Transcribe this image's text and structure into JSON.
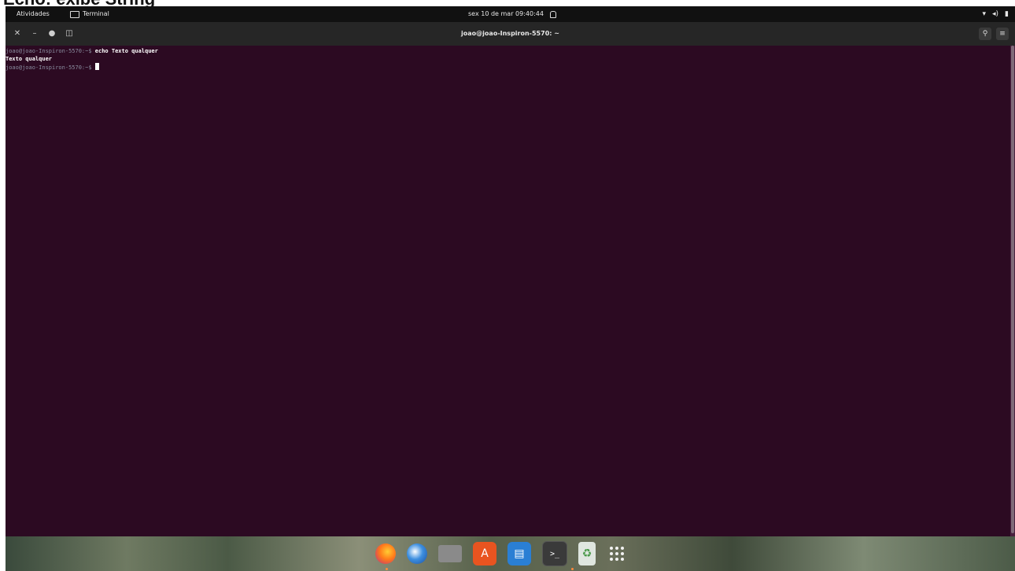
{
  "caption": "Echo: exibe String",
  "topbar": {
    "activities": "Atividades",
    "app_name": "Terminal",
    "clock": "sex 10 de mar  09:40:44"
  },
  "window": {
    "title": "joao@joao-Inspiron-5570: ~"
  },
  "terminal": {
    "lines": [
      {
        "prompt": "joao@joao-Inspiron-5570:~$",
        "command": " echo Texto qualquer"
      },
      {
        "output": "Texto qualquer"
      },
      {
        "prompt": "joao@joao-Inspiron-5570:~$",
        "command": " "
      }
    ]
  },
  "dock": {
    "items": [
      "firefox",
      "thunderbird",
      "files",
      "ubuntu-software",
      "libreoffice-writer",
      "terminal",
      "trash",
      "show-applications"
    ]
  },
  "colors": {
    "terminal_bg": "#2c0a22",
    "topbar_bg": "#111111",
    "headerbar_bg": "#262626"
  }
}
